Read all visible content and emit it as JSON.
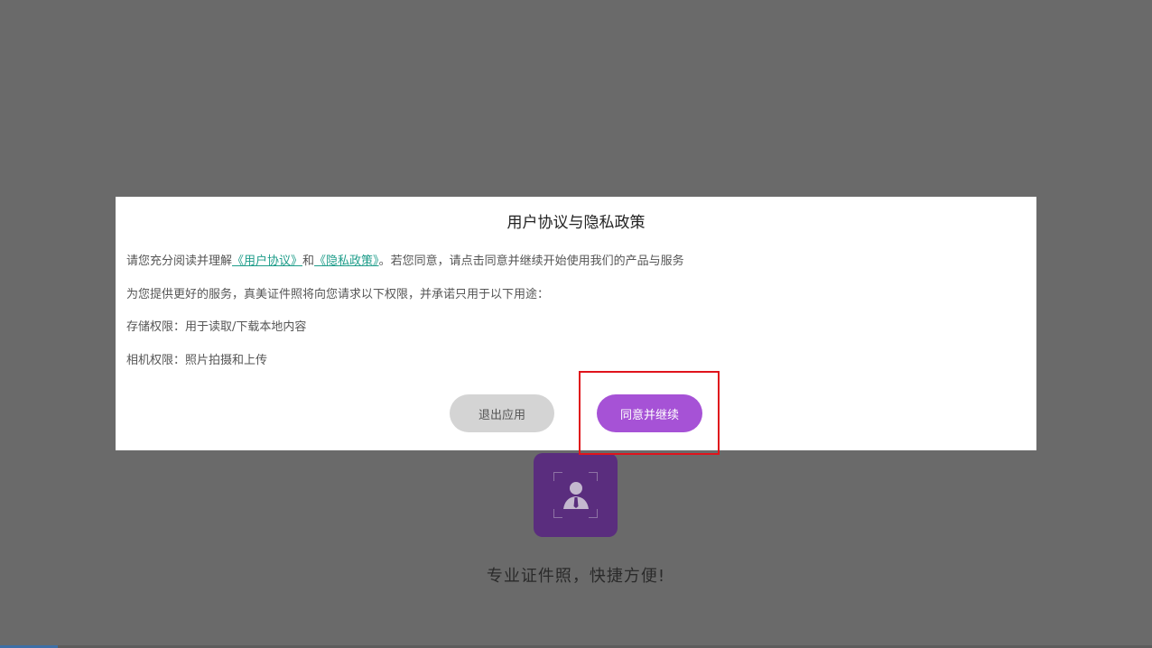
{
  "splash": {
    "logo_icon": "id-photo-person-icon",
    "slogan": "专业证件照，快捷方便!"
  },
  "dialog": {
    "title": "用户协议与隐私政策",
    "line1_prefix": "请您充分阅读并理解",
    "user_agreement_link": "《用户协议》",
    "line1_and": "和",
    "privacy_policy_link": "《隐私政策》",
    "line1_suffix": "。若您同意，请点击同意并继续开始使用我们的产品与服务",
    "line2": "为您提供更好的服务，真美证件照将向您请求以下权限，并承诺只用于以下用途：",
    "line3": "存储权限：用于读取/下载本地内容",
    "line4": "相机权限：照片拍摄和上传",
    "exit_label": "退出应用",
    "agree_label": "同意并继续"
  },
  "colors": {
    "overlay": "#6a6a6a",
    "link": "#1f9d8a",
    "agree_button": "#a652d6",
    "exit_button": "#d4d4d4",
    "highlight": "#e0141c"
  }
}
